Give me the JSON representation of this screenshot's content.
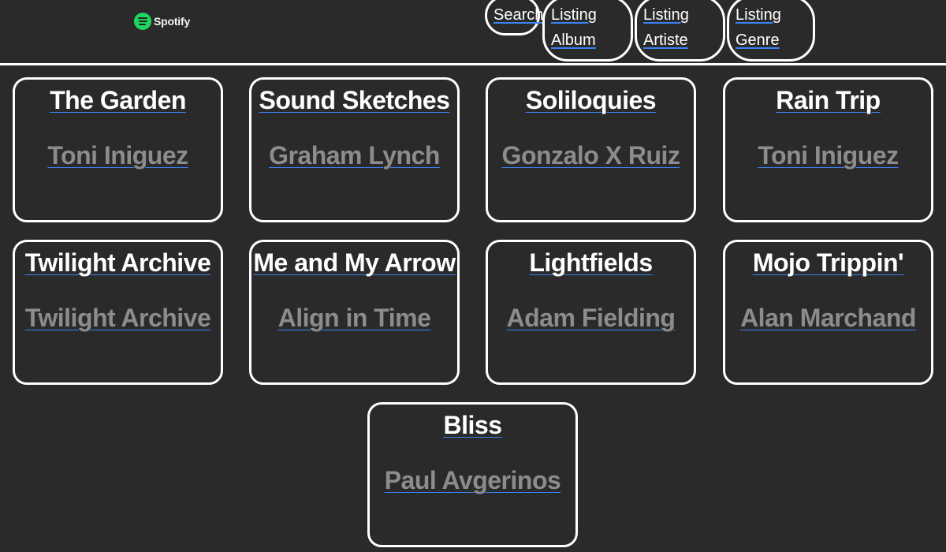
{
  "header": {
    "logo_text": "Spotify",
    "nav": {
      "search": "Search",
      "album_line1": "Listing",
      "album_line2": "Album",
      "artist_line1": "Listing",
      "artist_line2": "Artiste",
      "genre_line1": "Listing",
      "genre_line2": "Genre"
    }
  },
  "albums": [
    {
      "title": "The Garden",
      "artist": "Toni Iniguez"
    },
    {
      "title": "Sound Sketches",
      "artist": "Graham Lynch"
    },
    {
      "title": "Soliloquies",
      "artist": "Gonzalo X Ruiz"
    },
    {
      "title": "Rain Trip",
      "artist": "Toni Iniguez"
    },
    {
      "title": "Twilight Archive",
      "artist": "Twilight Archive"
    },
    {
      "title": "Me and My Arrow",
      "artist": "Align in Time"
    },
    {
      "title": "Lightfields",
      "artist": "Adam Fielding"
    },
    {
      "title": "Mojo Trippin'",
      "artist": "Alan Marchand"
    },
    {
      "title": "Bliss",
      "artist": "Paul Avgerinos"
    }
  ],
  "colors": {
    "background": "#2b2a2a",
    "border": "#ffffff",
    "title": "#ffffff",
    "artist": "#8c8c8c",
    "link_underline": "#3b82f6",
    "logo_green": "#1ed760"
  }
}
